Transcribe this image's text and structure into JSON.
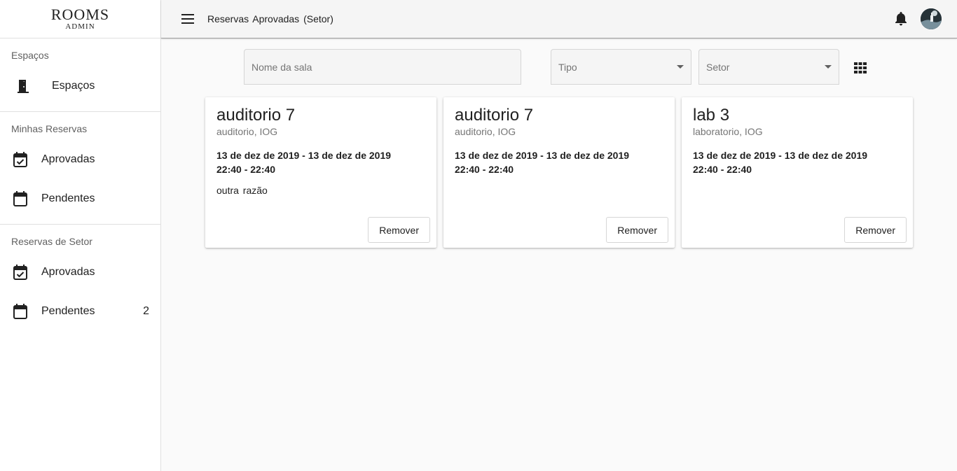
{
  "brand": {
    "title": "ROOMS",
    "subtitle": "ADMIN"
  },
  "sidebar": {
    "sections": [
      {
        "header": "Espaços",
        "items": [
          {
            "label": "Espaços",
            "icon": "door-icon"
          }
        ]
      },
      {
        "header": "Minhas Reservas",
        "items": [
          {
            "label": "Aprovadas",
            "icon": "calendar-check-icon"
          },
          {
            "label": "Pendentes",
            "icon": "calendar-icon"
          }
        ]
      },
      {
        "header": "Reservas de Setor",
        "items": [
          {
            "label": "Aprovadas",
            "icon": "calendar-check-icon"
          },
          {
            "label": "Pendentes",
            "icon": "calendar-icon",
            "count": "2"
          }
        ]
      }
    ]
  },
  "toolbar": {
    "title": "Reservas Aprovadas (Setor)"
  },
  "filters": {
    "room_name_placeholder": "Nome da sala",
    "type_label": "Tipo",
    "sector_label": "Setor"
  },
  "cards": [
    {
      "title": "auditorio 7",
      "subtitle": "auditorio, IOG",
      "dates": "13 de dez de 2019 - 13 de dez de 2019",
      "times": "22:40 - 22:40",
      "reason": "outra razão",
      "button": "Remover"
    },
    {
      "title": "auditorio 7",
      "subtitle": "auditorio, IOG",
      "dates": "13 de dez de 2019 - 13 de dez de 2019",
      "times": "22:40 - 22:40",
      "reason": "",
      "button": "Remover"
    },
    {
      "title": "lab 3",
      "subtitle": "laboratorio, IOG",
      "dates": "13 de dez de 2019 - 13 de dez de 2019",
      "times": "22:40 - 22:40",
      "reason": "",
      "button": "Remover"
    }
  ],
  "colors": {
    "toolbar_bg": "#f5f5f5",
    "sidebar_bg": "#ffffff",
    "page_bg": "#fafafa",
    "text": "#212121",
    "muted": "#757575"
  }
}
